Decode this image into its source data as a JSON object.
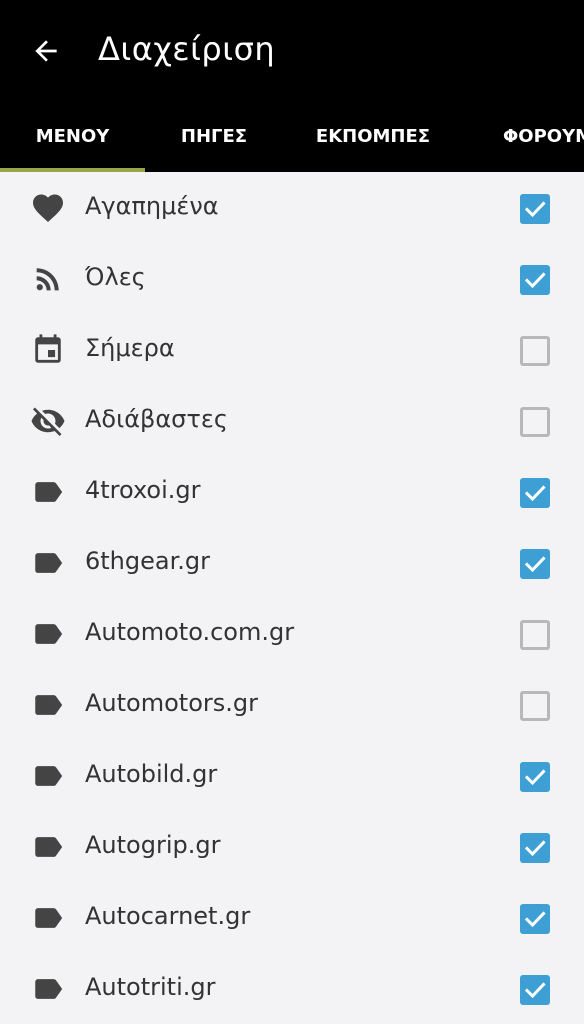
{
  "header": {
    "title": "Διαχείριση",
    "back_icon": "arrow-back-icon"
  },
  "tabs": [
    {
      "label": "ΜΕΝΟΥ",
      "active": true
    },
    {
      "label": "ΠΗΓΕΣ",
      "active": false
    },
    {
      "label": "ΕΚΠΟΜΠΕΣ",
      "active": false
    },
    {
      "label": "ΦΟΡΟΥΜ",
      "active": false
    }
  ],
  "colors": {
    "accent": "#3d9fd3",
    "tab_indicator": "#9aa545",
    "header_bg": "#000000",
    "list_bg": "#f3f3f5"
  },
  "items": [
    {
      "label": "Αγαπημένα",
      "icon": "heart-icon",
      "checked": true
    },
    {
      "label": "Όλες",
      "icon": "rss-icon",
      "checked": true
    },
    {
      "label": "Σήμερα",
      "icon": "calendar-icon",
      "checked": false
    },
    {
      "label": "Αδιάβαστες",
      "icon": "eye-off-icon",
      "checked": false
    },
    {
      "label": "4troxoi.gr",
      "icon": "label-icon",
      "checked": true
    },
    {
      "label": "6thgear.gr",
      "icon": "label-icon",
      "checked": true
    },
    {
      "label": "Automoto.com.gr",
      "icon": "label-icon",
      "checked": false
    },
    {
      "label": "Automotors.gr",
      "icon": "label-icon",
      "checked": false
    },
    {
      "label": "Autobild.gr",
      "icon": "label-icon",
      "checked": true
    },
    {
      "label": "Autogrip.gr",
      "icon": "label-icon",
      "checked": true
    },
    {
      "label": "Autocarnet.gr",
      "icon": "label-icon",
      "checked": true
    },
    {
      "label": "Autotriti.gr",
      "icon": "label-icon",
      "checked": true
    }
  ]
}
